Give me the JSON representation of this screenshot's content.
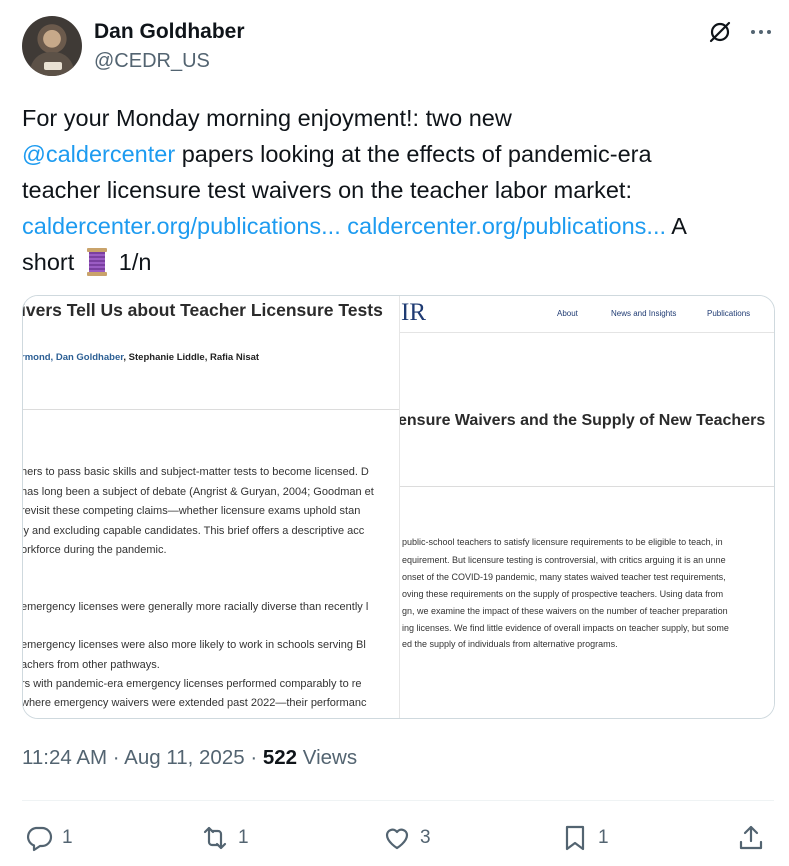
{
  "author": {
    "name": "Dan Goldhaber",
    "handle": "@CEDR_US"
  },
  "tweet": {
    "line1": "For your Monday morning enjoyment!: two new",
    "mention": "@caldercenter",
    "line2_rest": " papers looking at the effects of pandemic-era",
    "line3": "teacher licensure test waivers on the teacher labor market:",
    "link1": "caldercenter.org/publications...",
    "link2": "caldercenter.org/publications...",
    "line4_tail": " A",
    "line5_start": "short",
    "thread_count": "1/n"
  },
  "media": {
    "left": {
      "title": "ivers Tell Us about Teacher Licensure Tests",
      "author1": "rmond, Dan Goldhaber",
      "authors_rest": ", Stephanie Liddle,  Rafia Nisat",
      "lines": [
        "hers to pass basic skills and subject-matter tests to become licensed. D",
        "has long been a subject of debate (Angrist & Guryan, 2004; Goodman et",
        "revisit these competing claims—whether licensure exams uphold stan",
        "ly and excluding capable candidates. This brief offers a descriptive acc",
        "orkforce during the pandemic.",
        "emergency licenses were generally more racially diverse than recently l",
        "emergency licenses were also more likely to work in schools serving Bl",
        "achers from other pathways.",
        "rs with pandemic-era emergency licenses performed comparably to re",
        "where emergency waivers were extended past 2022—their performanc"
      ]
    },
    "right": {
      "logo": "IR",
      "nav": [
        "About",
        "News and Insights",
        "Publications"
      ],
      "heading": "ensure Waivers and the Supply of New Teachers",
      "lines": [
        "public-school teachers to satisfy licensure requirements to be eligible to teach, in",
        "equirement. But licensure testing is controversial, with critics arguing it is an unne",
        "onset of the COVID-19 pandemic, many states waived teacher test requirements,",
        "oving these requirements on the supply of prospective teachers. Using data from",
        "gn, we examine the impact of these waivers on the number of teacher preparation",
        "ing licenses. We find little evidence of overall impacts on teacher supply, but some",
        "ed the supply of individuals from alternative programs."
      ]
    }
  },
  "meta": {
    "time": "11:24 AM · Aug 11, 2025 · ",
    "views": "522",
    "views_label": " Views"
  },
  "actions": {
    "replies": "1",
    "reposts": "1",
    "likes": "3",
    "bookmarks": "1"
  },
  "icons": [
    "grok-icon",
    "more-icon",
    "reply-icon",
    "repost-icon",
    "like-icon",
    "bookmark-icon",
    "share-icon",
    "thread-spool-icon"
  ],
  "colors": {
    "link": "#1d9bf0",
    "secondary": "#536471",
    "text": "#0f1419"
  }
}
